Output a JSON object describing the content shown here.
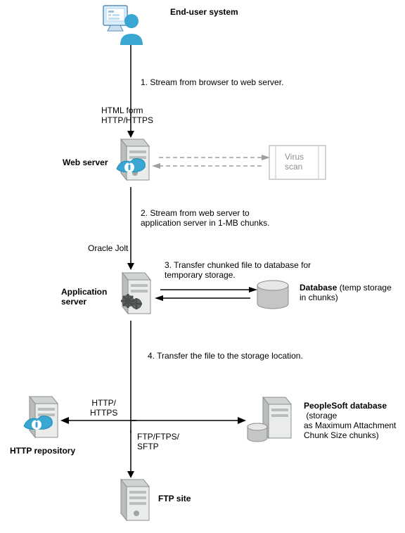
{
  "nodes": {
    "end_user": "End-user system",
    "web_server": "Web server",
    "app_server": "Application\nserver",
    "database": "Database",
    "database_note": " (temp storage\nin chunks)",
    "ps_db": "PeopleSoft database",
    "ps_db_note": " (storage\nas Maximum Attachment\nChunk Size chunks)",
    "http_repo": "HTTP repository",
    "ftp_site": "FTP site",
    "virus_scan": "Virus\nscan"
  },
  "steps": {
    "s1": "1. Stream from browser to web server.",
    "s2": "2. Stream from web server to\napplication server in 1-MB chunks.",
    "s3": "3. Transfer chunked file to database for\ntemporary storage.",
    "s4": "4. Transfer the file to the storage location."
  },
  "edges": {
    "html_http": "HTML form\nHTTP/HTTPS",
    "jolt": "Oracle Jolt",
    "http": "HTTP/\nHTTPS",
    "ftp": "FTP/FTPS/\nSFTP"
  }
}
